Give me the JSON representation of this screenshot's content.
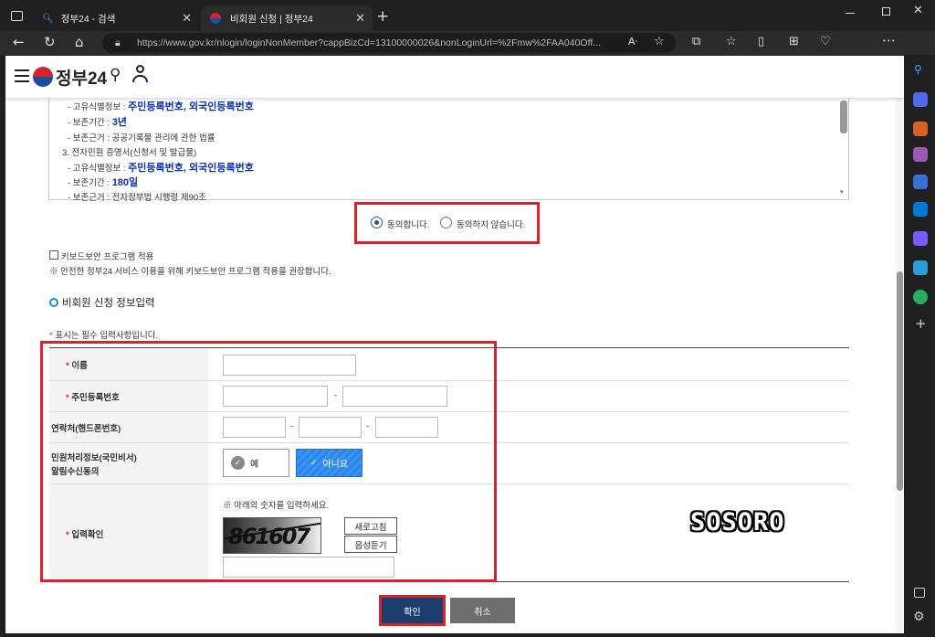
{
  "browser": {
    "tabs": [
      {
        "title": "정부24 - 검색"
      },
      {
        "title": "비회원 신청 | 정부24"
      }
    ],
    "url": "https://www.gov.kr/nlogin/loginNonMember?cappBizCd=13100000026&nonLoginUrl=%2Fmw%2FAA040Off..."
  },
  "header": {
    "logo_text": "정부24"
  },
  "terms": {
    "lines": [
      {
        "label": "- 고유식별정보 : ",
        "value": "주민등록번호, 외국인등록번호"
      },
      {
        "label": "- 보존기간 : ",
        "value": "3년"
      },
      {
        "label": "- 보존근거 : 공공기록물 관리에 관한 법률",
        "value": ""
      },
      {
        "label": "3. 전자민원 증명서(신청서 및 발급물)",
        "value": ""
      },
      {
        "label": "- 고유식별정보 : ",
        "value": "주민등록번호, 외국인등록번호"
      },
      {
        "label": "- 보존기간 : ",
        "value": "180일"
      },
      {
        "label": "- 보존근거 : 전자정부법 시행령 제90조",
        "value": ""
      }
    ]
  },
  "consent": {
    "agree": "동의합니다.",
    "disagree": "동의하지 않습니다.",
    "selected": "agree"
  },
  "keyboard": {
    "label": "키보드보안 프로그램 적용",
    "note": "※ 안전한 정부24 서비스 이용을 위해 키보드보안 프로그램 적용을 권장합니다."
  },
  "section": {
    "title": "비회원 신청 정보입력",
    "required_note": "표시는 필수 입력사항입니다."
  },
  "form": {
    "name_label": "이름",
    "rrn_label": "주민등록번호",
    "phone_label": "연락처(핸드폰번호)",
    "notify_label_1": "민원처리정보(국민비서)",
    "notify_label_2": "알림수신동의",
    "yes": "예",
    "no": "아니요",
    "captcha_label": "입력확인",
    "captcha_hint": "※ 아래의 숫자를 입력하세요.",
    "captcha_text": "861607",
    "refresh": "새로고침",
    "audio": "음성듣기"
  },
  "actions": {
    "confirm": "확인",
    "cancel": "취소"
  },
  "watermark": "SOSORO"
}
